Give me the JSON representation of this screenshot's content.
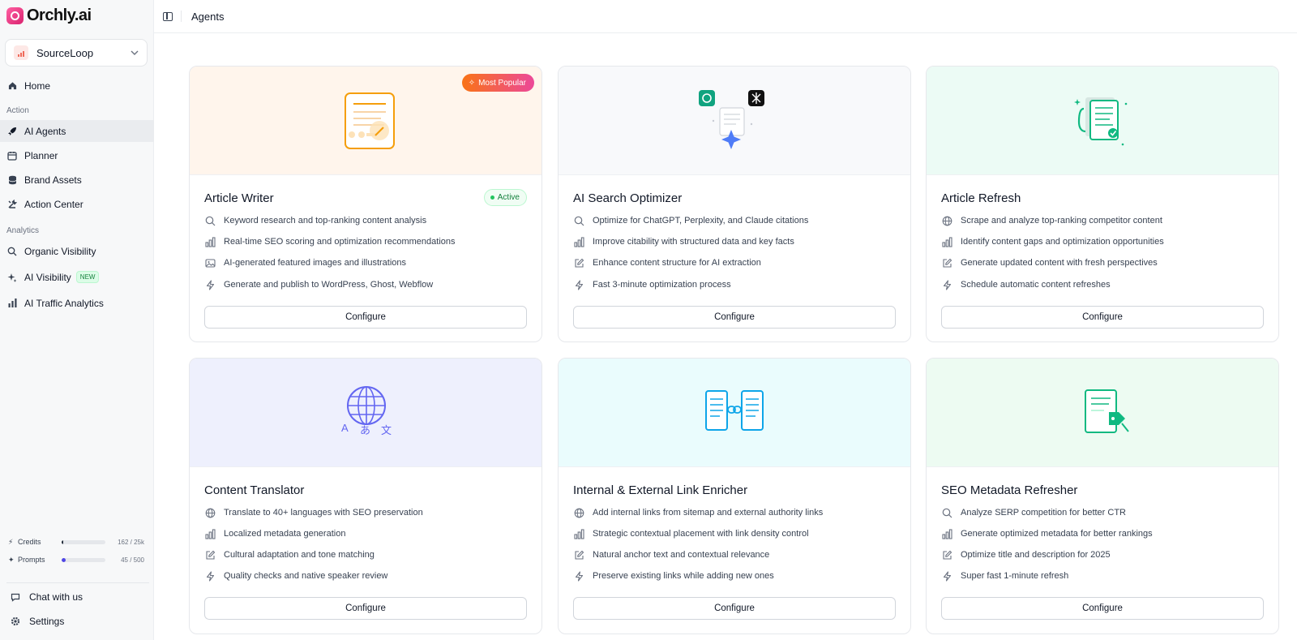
{
  "brand": {
    "name": "Orchly.ai"
  },
  "workspace": {
    "name": "SourceLoop"
  },
  "nav": {
    "home": "Home",
    "section_action": "Action",
    "ai_agents": "AI Agents",
    "planner": "Planner",
    "brand_assets": "Brand Assets",
    "action_center": "Action Center",
    "section_analytics": "Analytics",
    "organic_visibility": "Organic Visibility",
    "ai_visibility": "AI Visibility",
    "new_badge": "NEW",
    "ai_traffic_analytics": "AI Traffic Analytics"
  },
  "usage": {
    "credits": {
      "label": "Credits",
      "value": "162 / 25k",
      "fraction": 0.0065
    },
    "prompts": {
      "label": "Prompts",
      "value": "45 / 500",
      "fraction": 0.09
    }
  },
  "footer": {
    "chat": "Chat with us",
    "settings": "Settings"
  },
  "header": {
    "title": "Agents"
  },
  "cards": [
    {
      "title": "Article Writer",
      "badge": "Most Popular",
      "status": "Active",
      "hero_color": "#fff5ec",
      "features": [
        {
          "icon": "search-icon",
          "text": "Keyword research and top-ranking content analysis"
        },
        {
          "icon": "bar-chart-icon",
          "text": "Real-time SEO scoring and optimization recommendations"
        },
        {
          "icon": "image-icon",
          "text": "AI-generated featured images and illustrations"
        },
        {
          "icon": "lightning-icon",
          "text": "Generate and publish to WordPress, Ghost, Webflow"
        }
      ],
      "cta": "Configure"
    },
    {
      "title": "AI Search Optimizer",
      "hero_color": "#f8f9fb",
      "features": [
        {
          "icon": "search-icon",
          "text": "Optimize for ChatGPT, Perplexity, and Claude citations"
        },
        {
          "icon": "bar-chart-icon",
          "text": "Improve citability with structured data and key facts"
        },
        {
          "icon": "edit-icon",
          "text": "Enhance content structure for AI extraction"
        },
        {
          "icon": "lightning-icon",
          "text": "Fast 3-minute optimization process"
        }
      ],
      "cta": "Configure"
    },
    {
      "title": "Article Refresh",
      "hero_color": "#ecfbf5",
      "features": [
        {
          "icon": "globe-icon",
          "text": "Scrape and analyze top-ranking competitor content"
        },
        {
          "icon": "bar-chart-icon",
          "text": "Identify content gaps and optimization opportunities"
        },
        {
          "icon": "edit-icon",
          "text": "Generate updated content with fresh perspectives"
        },
        {
          "icon": "lightning-icon",
          "text": "Schedule automatic content refreshes"
        }
      ],
      "cta": "Configure"
    },
    {
      "title": "Content Translator",
      "hero_color": "#eef0fd",
      "hero_glyphs": [
        "A",
        "あ",
        "文"
      ],
      "features": [
        {
          "icon": "globe-icon",
          "text": "Translate to 40+ languages with SEO preservation"
        },
        {
          "icon": "bar-chart-icon",
          "text": "Localized metadata generation"
        },
        {
          "icon": "edit-icon",
          "text": "Cultural adaptation and tone matching"
        },
        {
          "icon": "lightning-icon",
          "text": "Quality checks and native speaker review"
        }
      ],
      "cta": "Configure"
    },
    {
      "title": "Internal & External Link Enricher",
      "hero_color": "#eafcfd",
      "features": [
        {
          "icon": "globe-icon",
          "text": "Add internal links from sitemap and external authority links"
        },
        {
          "icon": "bar-chart-icon",
          "text": "Strategic contextual placement with link density control"
        },
        {
          "icon": "edit-icon",
          "text": "Natural anchor text and contextual relevance"
        },
        {
          "icon": "lightning-icon",
          "text": "Preserve existing links while adding new ones"
        }
      ],
      "cta": "Configure"
    },
    {
      "title": "SEO Metadata Refresher",
      "hero_color": "#edfbf2",
      "features": [
        {
          "icon": "search-icon",
          "text": "Analyze SERP competition for better CTR"
        },
        {
          "icon": "bar-chart-icon",
          "text": "Generate optimized metadata for better rankings"
        },
        {
          "icon": "edit-icon",
          "text": "Optimize title and description for 2025"
        },
        {
          "icon": "lightning-icon",
          "text": "Super fast 1-minute refresh"
        }
      ],
      "cta": "Configure"
    }
  ]
}
